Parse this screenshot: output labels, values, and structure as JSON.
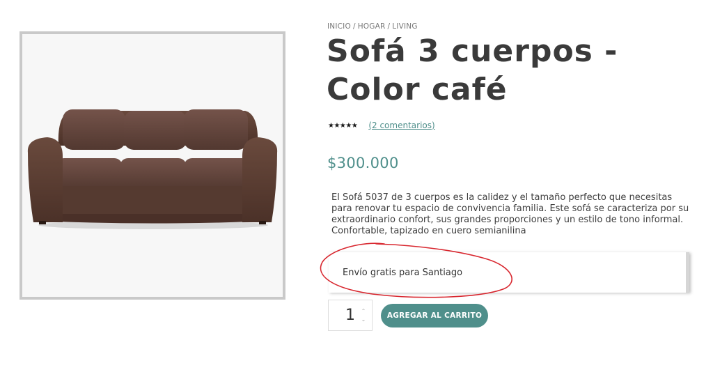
{
  "breadcrumb": {
    "items": [
      "INICIO",
      "HOGAR",
      "LIVING"
    ],
    "separator": "/"
  },
  "product": {
    "title_line1": "Sofá 3 cuerpos -",
    "title_line2": "Color café",
    "rating_stars": "★★★★★",
    "rating_value": 5,
    "reviews_link": "(2 comentarios)",
    "price": "$300.000",
    "description": "El Sofá 5037 de 3 cuerpos es la calidez y el tamaño perfecto que necesitas para renovar tu espacio de convivencia familia. Este sofá se caracteriza por su extraordinario confort, sus grandes proporciones y un estilo de tono informal. Confortable, tapizado en cuero semianilina",
    "image_icon": "sofa-image"
  },
  "shipping": {
    "label": "Envío gratis para Santiago"
  },
  "annotation": {
    "color": "#d8262e",
    "shape": "hand-drawn-ellipse"
  },
  "cart": {
    "quantity": "1",
    "up_icon": "chevron-up-icon",
    "down_icon": "chevron-down-icon",
    "button_label": "AGREGAR AL CARRITO"
  },
  "colors": {
    "accent": "#4f8f8b",
    "title": "#3a3a3a",
    "frame": "#c9c9c9"
  }
}
